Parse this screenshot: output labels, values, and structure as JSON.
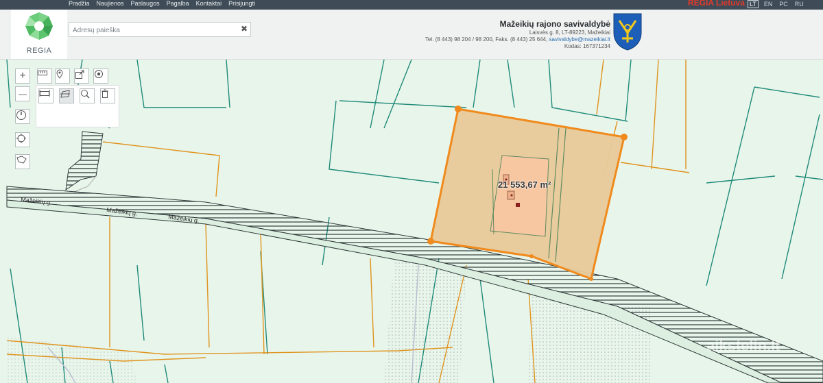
{
  "topnav": {
    "menu": [
      "Pradžia",
      "Naujienos",
      "Paslaugos",
      "Pagalba",
      "Kontaktai",
      "Prisijungti"
    ],
    "brand": "REGIA Lietuva",
    "languages": [
      "LT",
      "EN",
      "РС",
      "RU"
    ]
  },
  "logo": {
    "text": "REGIA"
  },
  "search": {
    "placeholder": "Adresų paieška",
    "clear": "✖"
  },
  "municipality": {
    "name": "Mažeikių rajono savivaldybė",
    "address": "Laisvės g. 8, LT-89223, Mažeikiai",
    "phones": "Tel. (8 443) 98 204 / 98 200, Faks. (8 443) 25 644,",
    "email": "savivaldybe@mazeikiai.lt",
    "code": "Kodas: 167371234"
  },
  "map": {
    "area_label": "21 553,67 m²",
    "road_labels": [
      "Mažeikių g.",
      "Mažeikių g.",
      "Mažeikių g."
    ],
    "watermark": "aikstelin.lt",
    "colors": {
      "background": "#e8f5ea",
      "parcel_fill": "#e8c99a",
      "parcel_outline": "#f08a1c",
      "line_teal": "#1f8a7a",
      "line_orange": "#e0931e"
    }
  },
  "tools": {
    "zoom_in": "+",
    "zoom_out": "—",
    "icons": [
      "ruler-icon",
      "pin-icon",
      "export-icon",
      "target-icon",
      "measure-distance-icon",
      "measure-area-icon",
      "identify-icon",
      "delete-icon",
      "compass-icon",
      "locate-icon",
      "polygon-select-icon"
    ]
  }
}
